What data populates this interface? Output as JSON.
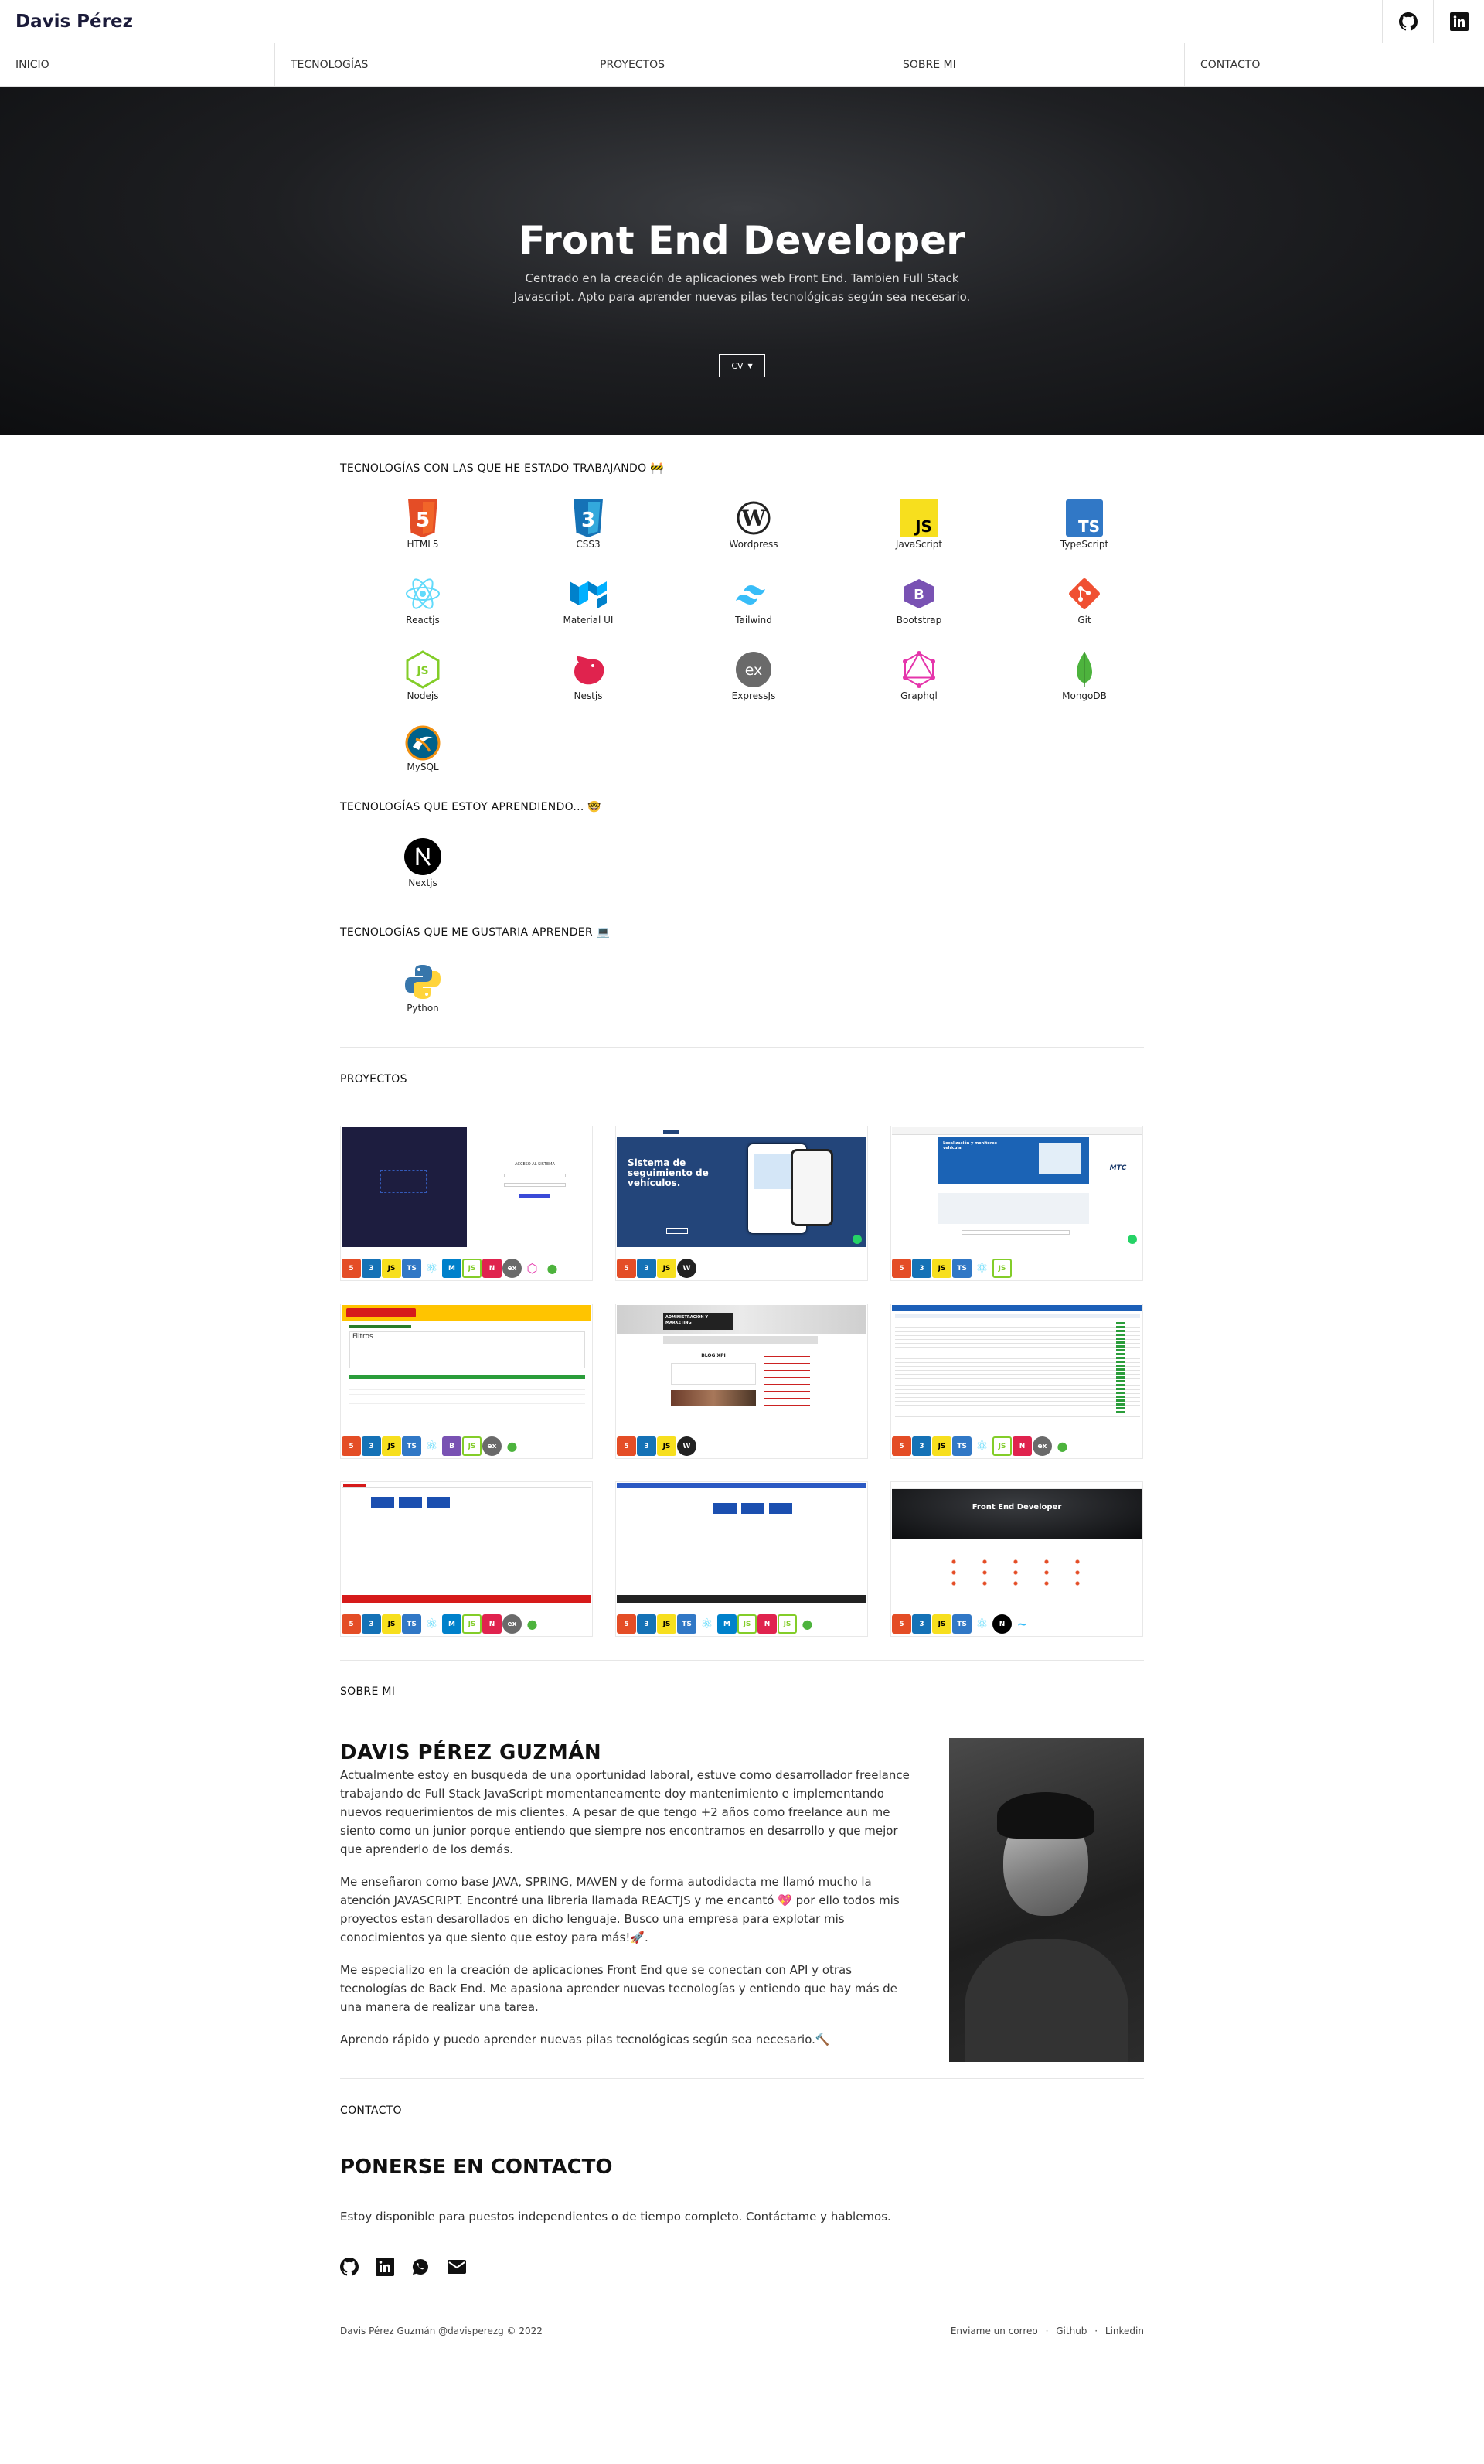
{
  "brand": "Davis Pérez",
  "nav": [
    "INICIO",
    "TECNOLOGÍAS",
    "PROYECTOS",
    "SOBRE MI",
    "CONTACTO"
  ],
  "hero": {
    "title": "Front End Developer",
    "subtitle": "Centrado en la creación de aplicaciones web Front End. Tambien Full Stack Javascript. Apto para aprender nuevas pilas tecnológicas según sea necesario.",
    "cv_label": "CV"
  },
  "tech": {
    "working_title": "TECNOLOGÍAS CON LAS QUE HE ESTADO TRABAJANDO",
    "working": [
      "HTML5",
      "CSS3",
      "Wordpress",
      "JavaScript",
      "TypeScript",
      "Reactjs",
      "Material UI",
      "Tailwind",
      "Bootstrap",
      "Git",
      "Nodejs",
      "Nestjs",
      "ExpressJs",
      "Graphql",
      "MongoDB",
      "MySQL"
    ],
    "learning_title": "TECNOLOGÍAS QUE ESTOY APRENDIENDO...",
    "learning": [
      "Nextjs"
    ],
    "wish_title": "TECNOLOGÍAS QUE ME GUSTARIA APRENDER",
    "wish": [
      "Python"
    ]
  },
  "projects": {
    "title": "PROYECTOS",
    "shots": [
      {
        "login_title": "ACCESO AL SISTEMA"
      },
      {
        "headline": "Sistema de seguimiento de vehículos."
      },
      {
        "headline": "Localización y monitoreo vehicular",
        "badge": "MTC"
      },
      {
        "heading": "Filtros"
      },
      {
        "banner": "ADMINISTRACIÓN Y MARKETING",
        "section": "BLOG XPI"
      },
      {},
      {},
      {},
      {
        "title": "Front End Developer"
      }
    ]
  },
  "about": {
    "label": "SOBRE MI",
    "name": "DAVIS PÉREZ GUZMÁN",
    "paragraphs": [
      "Actualmente estoy en busqueda de una oportunidad laboral, estuve como desarrollador freelance trabajando de Full Stack JavaScript momentaneamente doy mantenimiento e implementando nuevos requerimientos de mis clientes. A pesar de que tengo +2 años como freelance aun me siento como un junior porque entiendo que siempre nos encontramos en desarrollo y que mejor que aprenderlo de los demás.",
      "Me enseñaron como base JAVA, SPRING, MAVEN y de forma autodidacta me llamó mucho la atención JAVASCRIPT. Encontré una libreria llamada REACTJS y me encantó 💖 por ello todos mis proyectos estan desarollados en dicho lenguaje. Busco una empresa para explotar mis conocimientos ya que siento que estoy para más!🚀.",
      "Me especializo en la creación de aplicaciones Front End que se conectan con API y otras tecnologías de Back End. Me apasiona aprender nuevas tecnologías y entiendo que hay más de una manera de realizar una tarea.",
      "Aprendo rápido y puedo aprender nuevas pilas tecnológicas según sea necesario.🔨"
    ]
  },
  "contact": {
    "label": "CONTACTO",
    "title": "PONERSE EN CONTACTO",
    "text": "Estoy disponible para puestos independientes o de tiempo completo. Contáctame y hablemos."
  },
  "footer": {
    "copyright": "Davis Pérez Guzmán @davisperezg © 2022",
    "links": [
      "Enviame un correo",
      "Github",
      "Linkedin"
    ],
    "separator": "·"
  },
  "colors": {
    "accent": "#1b1b3a",
    "hero_bg": "#111214"
  }
}
